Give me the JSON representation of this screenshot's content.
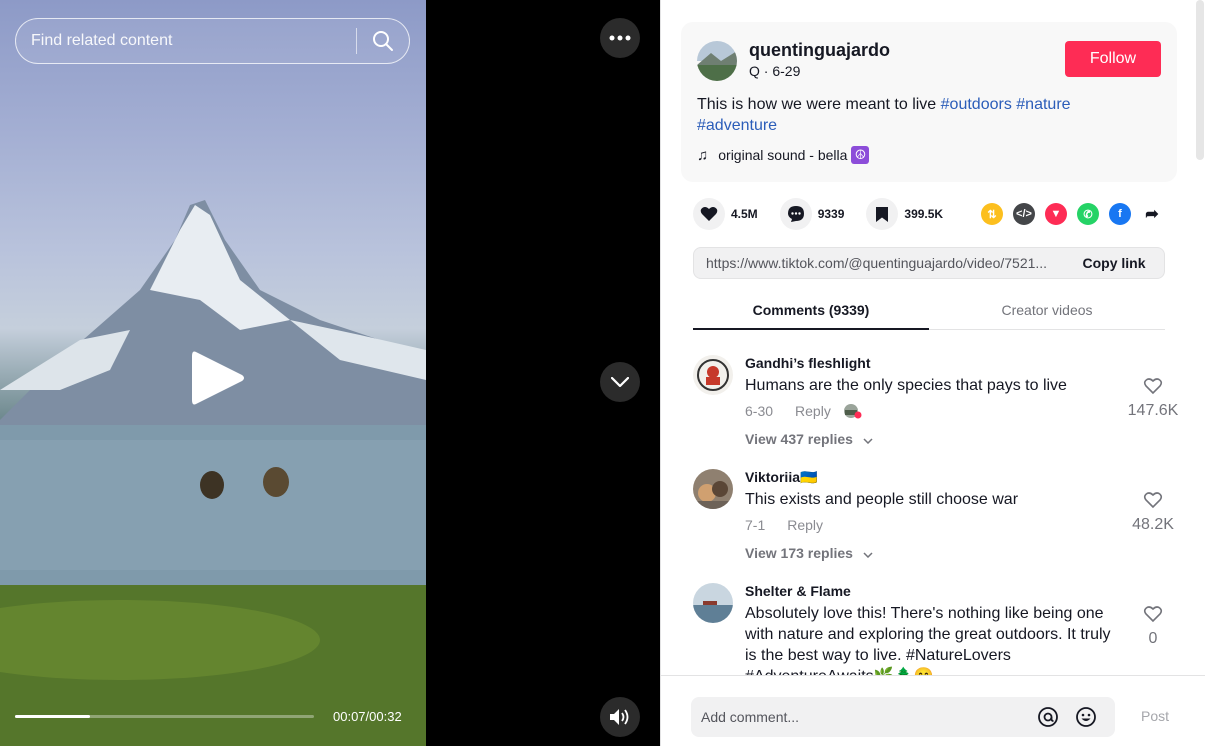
{
  "search": {
    "placeholder": "Find related content"
  },
  "player": {
    "time": "00:07/00:32",
    "progress": 0.25
  },
  "post": {
    "author": "quentinguajardo",
    "subtitle": "Q · 6-29",
    "follow_label": "Follow",
    "caption_text": "This is how we were meant to live ",
    "hashtags": [
      "#outdoors",
      "#nature",
      "#adventure"
    ],
    "music": "original sound - bella"
  },
  "actions": {
    "likes": "4.5M",
    "comments": "9339",
    "saves": "399.5K"
  },
  "share": {
    "link": "https://www.tiktok.com/@quentinguajardo/video/7521...",
    "copy_label": "Copy link"
  },
  "tabs": [
    {
      "label": "Comments (9339)",
      "active": true
    },
    {
      "label": "Creator videos",
      "active": false
    }
  ],
  "comments": [
    {
      "user": "Gandhi’s fleshlight",
      "text": "Humans are the only species that pays to live",
      "date": "6-30",
      "reply": "Reply",
      "replies": "View 437 replies",
      "likes": "147.6K"
    },
    {
      "user": "Viktoriia🇺🇦",
      "text": "This exists and people still choose war",
      "date": "7-1",
      "reply": "Reply",
      "replies": "View 173 replies",
      "likes": "48.2K"
    },
    {
      "user": "Shelter & Flame",
      "text": "Absolutely love this! There's nothing like being one with nature and exploring the great outdoors. It truly is the best way to live. #NatureLovers #AdventureAwaits🌿🌲😊",
      "likes": "0"
    }
  ],
  "composer": {
    "placeholder": "Add comment...",
    "post_label": "Post"
  },
  "colors": {
    "follow": "#fe2c55",
    "hashtag": "#2b5db9",
    "divider": "#e3e3e4"
  }
}
